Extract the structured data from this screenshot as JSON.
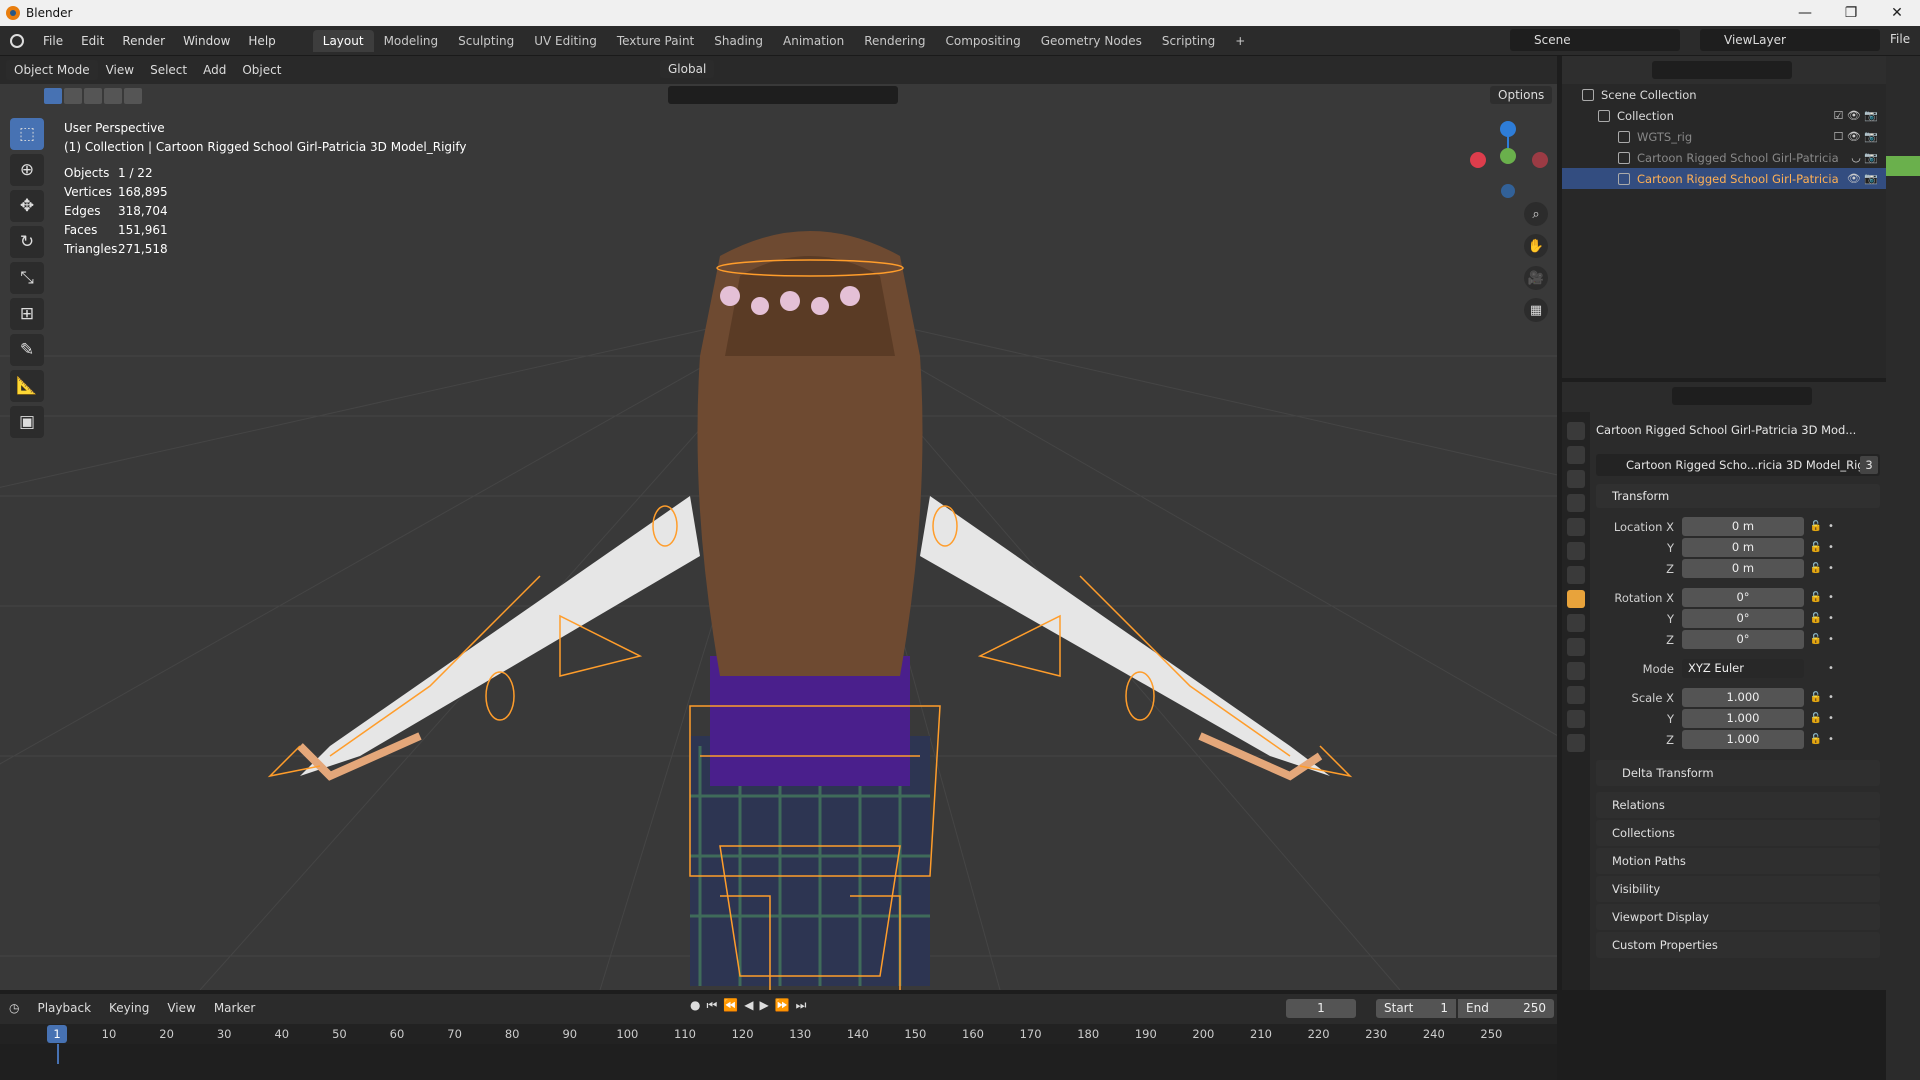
{
  "window": {
    "title": "Blender",
    "controls": [
      "—",
      "❐",
      "✕"
    ]
  },
  "topbar": {
    "menus": [
      "File",
      "Edit",
      "Render",
      "Window",
      "Help"
    ],
    "workspaces": [
      "Layout",
      "Modeling",
      "Sculpting",
      "UV Editing",
      "Texture Paint",
      "Shading",
      "Animation",
      "Rendering",
      "Compositing",
      "Geometry Nodes",
      "Scripting"
    ],
    "add_tab": "+",
    "scene": "Scene",
    "view_layer": "ViewLayer",
    "right_file": "File"
  },
  "viewport": {
    "mode": "Object Mode",
    "menus": [
      "View",
      "Select",
      "Add",
      "Object"
    ],
    "orientation": "Global",
    "options_label": "Options",
    "perspective": "User Perspective",
    "collection_line": "(1) Collection | Cartoon Rigged School Girl-Patricia 3D Model_Rigify",
    "stats": [
      {
        "label": "Objects",
        "value": "1 / 22"
      },
      {
        "label": "Vertices",
        "value": "168,895"
      },
      {
        "label": "Edges",
        "value": "318,704"
      },
      {
        "label": "Faces",
        "value": "151,961"
      },
      {
        "label": "Triangles",
        "value": "271,518"
      }
    ]
  },
  "outliner": {
    "items": [
      {
        "label": "Scene Collection",
        "indent": 0
      },
      {
        "label": "Collection",
        "indent": 1
      },
      {
        "label": "WGTS_rig",
        "indent": 2
      },
      {
        "label": "Cartoon Rigged School Girl-Patricia",
        "indent": 2
      },
      {
        "label": "Cartoon Rigged School Girl-Patricia",
        "indent": 2,
        "selected": true
      }
    ]
  },
  "properties": {
    "object_name": "Cartoon Rigged School Girl-Patricia 3D Mod...",
    "data_name": "Cartoon Rigged Scho...ricia 3D Model_Rigify",
    "data_users": "3",
    "transform_label": "Transform",
    "location": {
      "x_label": "Location X",
      "x": "0 m",
      "y": "0 m",
      "z": "0 m"
    },
    "rotation": {
      "x_label": "Rotation X",
      "x": "0°",
      "y": "0°",
      "z": "0°"
    },
    "mode": {
      "label": "Mode",
      "value": "XYZ Euler"
    },
    "scale": {
      "x_label": "Scale X",
      "x": "1.000",
      "y": "1.000",
      "z": "1.000"
    },
    "axis_y": "Y",
    "axis_z": "Z",
    "subpanels": [
      "Delta Transform",
      "Relations",
      "Collections",
      "Motion Paths",
      "Visibility",
      "Viewport Display",
      "Custom Properties"
    ]
  },
  "timeline": {
    "menus": [
      "Playback",
      "Keying",
      "View",
      "Marker"
    ],
    "current_frame": "1",
    "start_label": "Start",
    "start": "1",
    "end_label": "End",
    "end": "250",
    "ruler_ticks": [
      "10",
      "20",
      "30",
      "40",
      "50",
      "60",
      "70",
      "80",
      "90",
      "100",
      "110",
      "120",
      "130",
      "140",
      "150",
      "160",
      "170",
      "180",
      "190",
      "200",
      "210",
      "220",
      "230",
      "240",
      "250"
    ],
    "cursor": "1"
  },
  "colors": {
    "accent": "#4772b3",
    "selection": "#e8a33b",
    "active_object": "#ff9d2b"
  }
}
